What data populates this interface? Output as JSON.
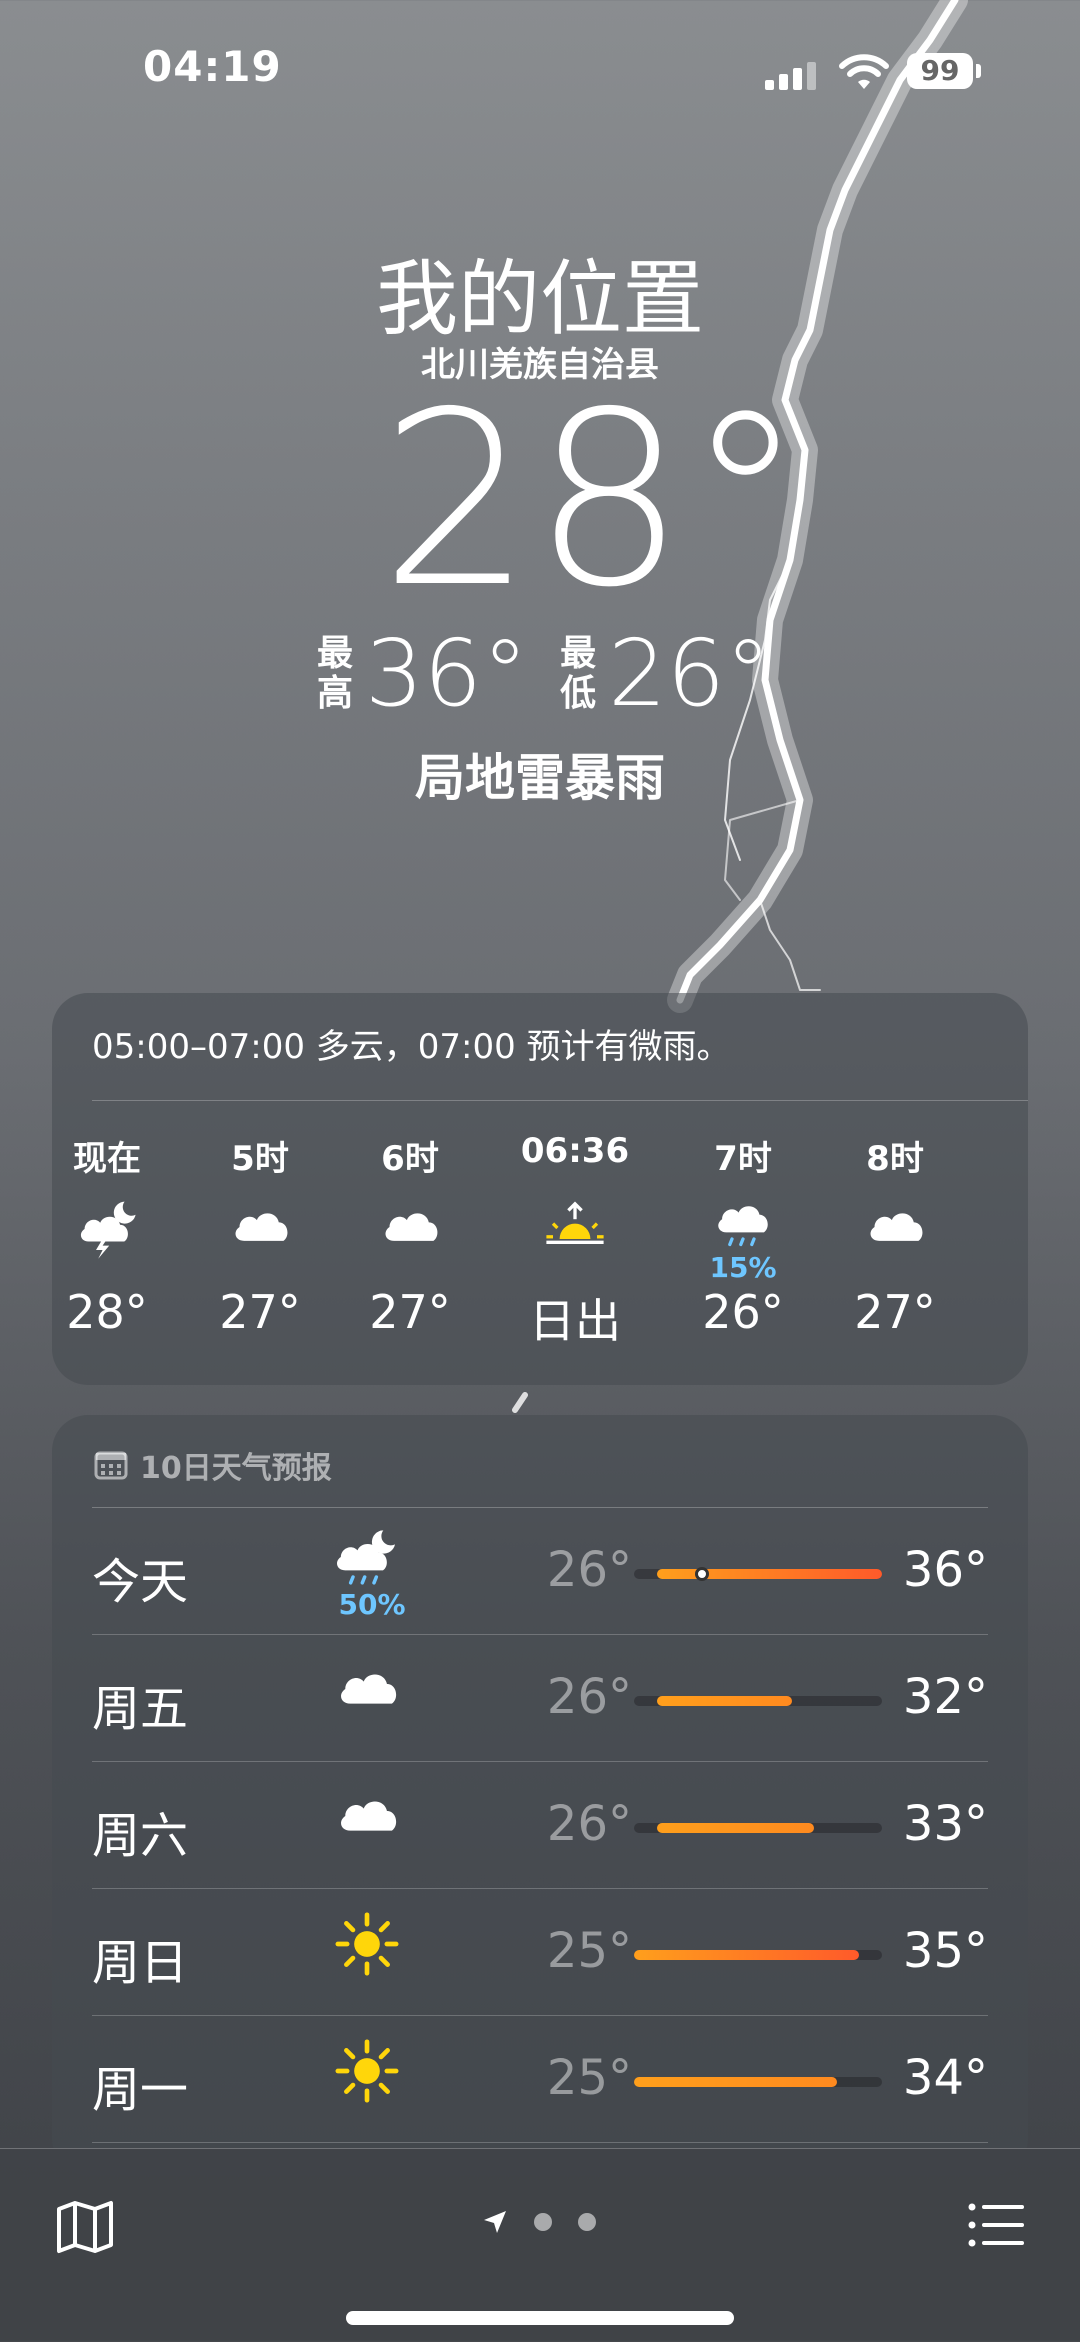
{
  "status_bar": {
    "time": "04:19",
    "battery": "99"
  },
  "header": {
    "location_title": "我的位置",
    "location_sub": "北川羌族自治县",
    "current_temp": "28°",
    "high_label": "最高",
    "high_value": "36°",
    "low_label": "最低",
    "low_value": "26°",
    "condition": "局地雷暴雨"
  },
  "hourly": {
    "summary": "05:00–07:00 多云，07:00 预计有微雨。",
    "items": [
      {
        "label": "现在",
        "icon": "thunderstorm-night-icon",
        "temp": "28°",
        "pct": ""
      },
      {
        "label": "5时",
        "icon": "cloud-icon",
        "temp": "27°",
        "pct": ""
      },
      {
        "label": "6时",
        "icon": "cloud-icon",
        "temp": "27°",
        "pct": ""
      },
      {
        "label": "06:36",
        "icon": "sunrise-icon",
        "temp": "日出",
        "pct": ""
      },
      {
        "label": "7时",
        "icon": "rain-cloud-icon",
        "temp": "26°",
        "pct": "15%"
      },
      {
        "label": "8时",
        "icon": "cloud-icon",
        "temp": "27°",
        "pct": ""
      }
    ]
  },
  "daily": {
    "header": "10日天气预报",
    "range_min": 25,
    "range_max": 36,
    "rows": [
      {
        "day": "今天",
        "icon": "rain-night-icon",
        "pct": "50%",
        "low": "26°",
        "high": "36°",
        "low_val": 26,
        "high_val": 36,
        "current_val": 28
      },
      {
        "day": "周五",
        "icon": "cloud-icon",
        "pct": "",
        "low": "26°",
        "high": "32°",
        "low_val": 26,
        "high_val": 32
      },
      {
        "day": "周六",
        "icon": "cloud-icon",
        "pct": "",
        "low": "26°",
        "high": "33°",
        "low_val": 26,
        "high_val": 33
      },
      {
        "day": "周日",
        "icon": "sun-icon",
        "pct": "",
        "low": "25°",
        "high": "35°",
        "low_val": 25,
        "high_val": 35
      },
      {
        "day": "周一",
        "icon": "sun-icon",
        "pct": "",
        "low": "25°",
        "high": "34°",
        "low_val": 25,
        "high_val": 34
      }
    ]
  },
  "colors": {
    "accent_orange": "#ff8a1f",
    "hot_red": "#ff5a2a",
    "rain_blue": "#6ec6ff",
    "sun_yellow": "#ffd60a"
  }
}
